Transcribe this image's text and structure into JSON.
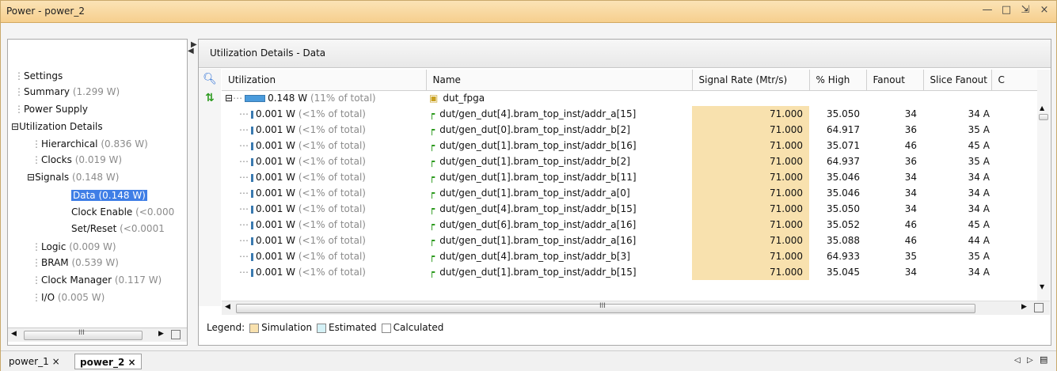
{
  "window": {
    "title": "Power - power_2",
    "controls": [
      "minimize-icon",
      "maximize-icon",
      "restore-icon",
      "close-icon"
    ]
  },
  "left_toolbar": [
    "search-icon",
    "expand-all-icon",
    "collapse-all-icon",
    "back-arrow-icon",
    "forward-arrow-icon"
  ],
  "tree": [
    {
      "label": "Settings",
      "value": ""
    },
    {
      "label": "Summary",
      "value": "(1.299 W)"
    },
    {
      "label": "Power Supply",
      "value": ""
    },
    {
      "label": "Utilization Details",
      "value": ""
    },
    {
      "label": "Hierarchical",
      "value": "(0.836 W)"
    },
    {
      "label": "Clocks",
      "value": "(0.019 W)"
    },
    {
      "label": "Signals",
      "value": "(0.148 W)"
    },
    {
      "label": "Data (0.148 W)",
      "value": ""
    },
    {
      "label": "Clock Enable",
      "value": "(<0.000"
    },
    {
      "label": "Set/Reset",
      "value": "(<0.0001 "
    },
    {
      "label": "Logic",
      "value": "(0.009 W)"
    },
    {
      "label": "BRAM",
      "value": "(0.539 W)"
    },
    {
      "label": "Clock Manager",
      "value": "(0.117 W)"
    },
    {
      "label": "I/O",
      "value": "(0.005 W)"
    }
  ],
  "panel": {
    "title": "Utilization Details - Data"
  },
  "columns": [
    "Utilization",
    "Name",
    "Signal Rate (Mtr/s)",
    "% High",
    "Fanout",
    "Slice Fanout",
    "C"
  ],
  "top_row": {
    "util_w": "0.148 W",
    "util_pct": "(11% of total)",
    "name": "dut_fpga"
  },
  "rows": [
    {
      "w": "0.001 W",
      "p": "(<1% of total)",
      "name": "dut/gen_dut[4].bram_top_inst/addr_a[15]",
      "rate": "71.000",
      "high": "35.050",
      "fanout": "34",
      "slice": "34",
      "c": "A"
    },
    {
      "w": "0.001 W",
      "p": "(<1% of total)",
      "name": "dut/gen_dut[0].bram_top_inst/addr_b[2]",
      "rate": "71.000",
      "high": "64.917",
      "fanout": "36",
      "slice": "35",
      "c": "A"
    },
    {
      "w": "0.001 W",
      "p": "(<1% of total)",
      "name": "dut/gen_dut[1].bram_top_inst/addr_b[16]",
      "rate": "71.000",
      "high": "35.071",
      "fanout": "46",
      "slice": "45",
      "c": "A"
    },
    {
      "w": "0.001 W",
      "p": "(<1% of total)",
      "name": "dut/gen_dut[1].bram_top_inst/addr_b[2]",
      "rate": "71.000",
      "high": "64.937",
      "fanout": "36",
      "slice": "35",
      "c": "A"
    },
    {
      "w": "0.001 W",
      "p": "(<1% of total)",
      "name": "dut/gen_dut[1].bram_top_inst/addr_b[11]",
      "rate": "71.000",
      "high": "35.046",
      "fanout": "34",
      "slice": "34",
      "c": "A"
    },
    {
      "w": "0.001 W",
      "p": "(<1% of total)",
      "name": "dut/gen_dut[1].bram_top_inst/addr_a[0]",
      "rate": "71.000",
      "high": "35.046",
      "fanout": "34",
      "slice": "34",
      "c": "A"
    },
    {
      "w": "0.001 W",
      "p": "(<1% of total)",
      "name": "dut/gen_dut[4].bram_top_inst/addr_b[15]",
      "rate": "71.000",
      "high": "35.050",
      "fanout": "34",
      "slice": "34",
      "c": "A"
    },
    {
      "w": "0.001 W",
      "p": "(<1% of total)",
      "name": "dut/gen_dut[6].bram_top_inst/addr_a[16]",
      "rate": "71.000",
      "high": "35.052",
      "fanout": "46",
      "slice": "45",
      "c": "A"
    },
    {
      "w": "0.001 W",
      "p": "(<1% of total)",
      "name": "dut/gen_dut[1].bram_top_inst/addr_a[16]",
      "rate": "71.000",
      "high": "35.088",
      "fanout": "46",
      "slice": "44",
      "c": "A"
    },
    {
      "w": "0.001 W",
      "p": "(<1% of total)",
      "name": "dut/gen_dut[4].bram_top_inst/addr_b[3]",
      "rate": "71.000",
      "high": "64.933",
      "fanout": "35",
      "slice": "35",
      "c": "A"
    },
    {
      "w": "0.001 W",
      "p": "(<1% of total)",
      "name": "dut/gen_dut[1].bram_top_inst/addr_b[15]",
      "rate": "71.000",
      "high": "35.045",
      "fanout": "34",
      "slice": "34",
      "c": "A"
    }
  ],
  "legend": {
    "label": "Legend:",
    "items": [
      {
        "label": "Simulation",
        "color": "#f8e1ae"
      },
      {
        "label": "Estimated",
        "color": "#d4f1f6"
      },
      {
        "label": "Calculated",
        "color": "#ffffff"
      }
    ]
  },
  "tabs": [
    {
      "label": "power_1"
    },
    {
      "label": "power_2"
    }
  ],
  "tab_close": "×",
  "scroll_mid": "III",
  "colors": {
    "titlebar": "#f6cf8e",
    "selection": "#3f7ee6",
    "simulation": "#f8e1ae"
  }
}
